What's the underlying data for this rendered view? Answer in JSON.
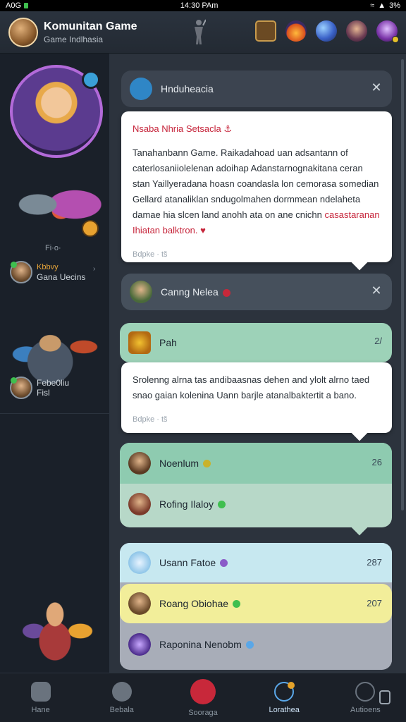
{
  "status_bar": {
    "left": "A0G",
    "time": "14:30 PAm",
    "battery": "3%"
  },
  "header": {
    "title": "Komunitan Game",
    "subtitle": "Game Indlhasia"
  },
  "sidebar": {
    "small_label": "Fi·o·",
    "user1": {
      "top": "Kbbvy",
      "name": "Gana Uecins"
    },
    "user2": {
      "top": "Febe0liu",
      "name": "Fisl"
    }
  },
  "main": {
    "card1": {
      "title": "Hnduheacia",
      "message": {
        "heading": "Nsaba Nhria Setsacla",
        "body": "Tanahanbann Game. Raikadahoad uan adsantann of caterlosaniiolelenan adoihap Adanstarnognakitana ceran stan Yaillyeradana hoasn coandasla lon cemorasa somedian Gellard atanaliklan sndugolmahen dormmean ndelaheta damae hia slcen land anohh ata on ane cnichn",
        "body_red": "casastaranan Ihiatan balktron.",
        "footer": "Bdpke · tš"
      }
    },
    "card2": {
      "title": "Canng Nelea",
      "message": {
        "body": "Srolenng alrna tas andibaasnas dehen and ylolt alrno taed snao gaian kolenina Uann barjle atanalbaktertit a bano.",
        "footer": "Bdpke · tš"
      }
    },
    "card3": {
      "title": "Pah",
      "count": "2/"
    },
    "green_rows": [
      {
        "name": "Noenlum",
        "count": "26"
      },
      {
        "name": "Rofing Ilaloy",
        "count": ""
      }
    ],
    "list_rows": [
      {
        "name": "Usann Fatoe",
        "count": "287"
      },
      {
        "name": "Roang Obiohae",
        "count": "207"
      },
      {
        "name": "Raponina Nenobm",
        "count": ""
      }
    ]
  },
  "bottom_nav": [
    {
      "label": "Hane",
      "active": false
    },
    {
      "label": "Bebala",
      "active": false
    },
    {
      "label": "Sooraga",
      "active": false
    },
    {
      "label": "Lorathea",
      "active": true
    },
    {
      "label": "Autioens",
      "active": false
    }
  ],
  "colors": {
    "accent_red": "#c6243a",
    "accent_blue": "#5aa7e8",
    "green_panel": "#8ecbb0",
    "yellow_row": "#f2ee9a"
  },
  "icons": {
    "header": [
      "treasure-icon",
      "fire-hero-icon",
      "planet-icon",
      "hero-portrait-icon",
      "mage-portrait-icon"
    ],
    "nav": [
      "home-icon",
      "battle-icon",
      "record-icon",
      "compass-icon",
      "people-icon"
    ]
  }
}
